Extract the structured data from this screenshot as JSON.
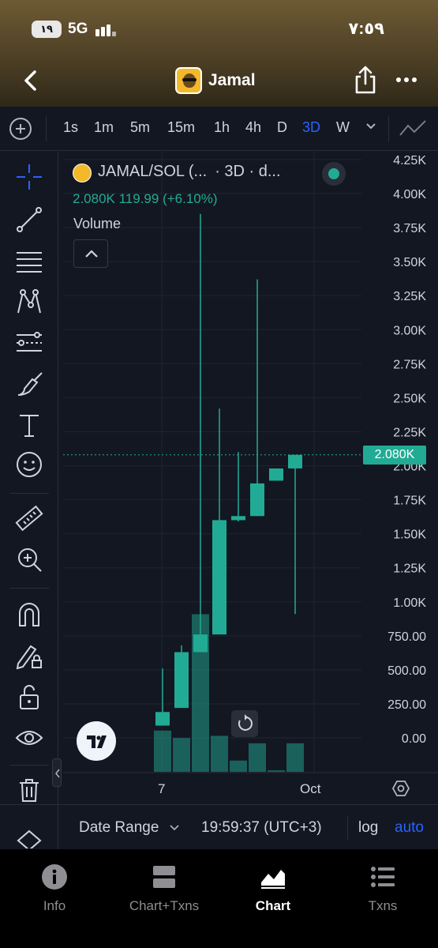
{
  "status_bar": {
    "badge": "١٩",
    "network": "5G",
    "time": "٧:٥٩"
  },
  "header": {
    "title": "Jamal",
    "back_icon": "chevron-left-icon",
    "share_icon": "share-icon",
    "more_icon": "ellipsis-icon"
  },
  "toolbar": {
    "timeframes": [
      "1s",
      "1m",
      "5m",
      "15m",
      "1h",
      "4h",
      "D",
      "3D",
      "W"
    ],
    "active_timeframe": "3D",
    "accent_color": "#2962ff"
  },
  "legend": {
    "symbol": "JAMAL/SOL (...",
    "interval_suffix": "· 3D · d...",
    "values": "2.080K  119.99 (+6.10%)",
    "volume_label": "Volume"
  },
  "price_tag": "2.080K",
  "chart_data": {
    "type": "candlestick",
    "y_ticks": [
      "4.25K",
      "4.00K",
      "3.75K",
      "3.50K",
      "3.25K",
      "3.00K",
      "2.75K",
      "2.50K",
      "2.25K",
      "2.00K",
      "1.75K",
      "1.50K",
      "1.25K",
      "1.00K",
      "750.00",
      "500.00",
      "250.00",
      "0.00"
    ],
    "x_ticks": [
      "7",
      "Oct"
    ],
    "ylim": [
      0,
      4250
    ],
    "last_price": 2080,
    "up_color": "#22ab94",
    "down_color": "#f23645",
    "candles": [
      {
        "open": 90,
        "close": 190,
        "high": 510,
        "low": 90
      },
      {
        "open": 220,
        "close": 630,
        "high": 680,
        "low": 220
      },
      {
        "open": 630,
        "close": 760,
        "high": 3850,
        "low": 630
      },
      {
        "open": 760,
        "close": 1600,
        "high": 2420,
        "low": 760
      },
      {
        "open": 1600,
        "close": 1630,
        "high": 2100,
        "low": 1590
      },
      {
        "open": 1630,
        "close": 1870,
        "high": 3370,
        "low": 1630
      },
      {
        "open": 1890,
        "close": 1980,
        "high": 1980,
        "low": 1890
      },
      {
        "open": 1980,
        "close": 2080,
        "high": 2080,
        "low": 910
      }
    ],
    "volume": [
      55,
      45,
      210,
      48,
      15,
      38,
      2,
      38
    ]
  },
  "bottom_bar": {
    "date_range": "Date Range",
    "clock": "19:59:37 (UTC+3)",
    "log": "log",
    "auto": "auto"
  },
  "tabs": [
    {
      "label": "Info",
      "icon": "info-icon"
    },
    {
      "label": "Chart+Txns",
      "icon": "split-view-icon"
    },
    {
      "label": "Chart",
      "icon": "chart-icon",
      "active": true
    },
    {
      "label": "Txns",
      "icon": "list-icon"
    }
  ]
}
